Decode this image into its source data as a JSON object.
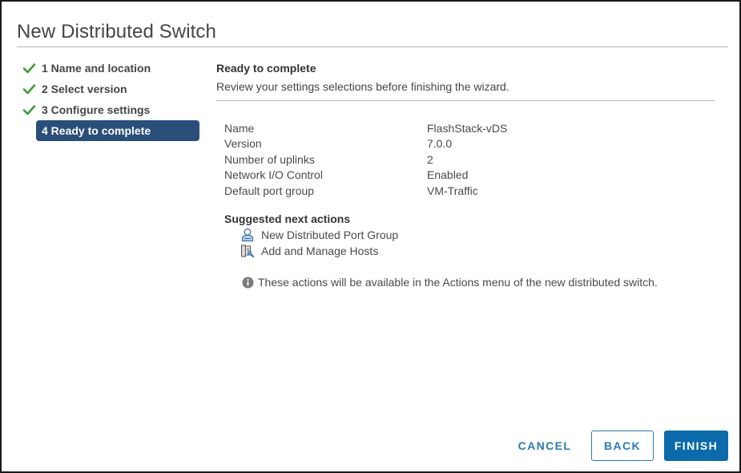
{
  "dialog": {
    "title": "New Distributed Switch"
  },
  "steps": [
    {
      "label": "1 Name and location",
      "state": "completed",
      "icon": "check-icon"
    },
    {
      "label": "2 Select version",
      "state": "completed",
      "icon": "check-icon"
    },
    {
      "label": "3 Configure settings",
      "state": "completed",
      "icon": "check-icon"
    },
    {
      "label": "4 Ready to complete",
      "state": "active"
    }
  ],
  "content": {
    "title": "Ready to complete",
    "subtitle": "Review your settings selections before finishing the wizard."
  },
  "summary": [
    {
      "label": "Name",
      "value": "FlashStack-vDS"
    },
    {
      "label": "Version",
      "value": "7.0.0"
    },
    {
      "label": "Number of uplinks",
      "value": "2"
    },
    {
      "label": "Network I/O Control",
      "value": "Enabled"
    },
    {
      "label": "Default port group",
      "value": "VM-Traffic"
    }
  ],
  "next_actions": {
    "title": "Suggested next actions",
    "items": [
      {
        "label": "New Distributed Port Group",
        "icon": "port-group-icon"
      },
      {
        "label": "Add and Manage Hosts",
        "icon": "manage-hosts-icon"
      }
    ],
    "info": "These actions will be available in the Actions menu of the new distributed switch."
  },
  "buttons": {
    "cancel": "CANCEL",
    "back": "BACK",
    "finish": "FINISH"
  },
  "colors": {
    "accent": "#0b6aa9",
    "active_step": "#2a4e7a",
    "check": "#3d9b35",
    "link": "#2b7ab3"
  }
}
